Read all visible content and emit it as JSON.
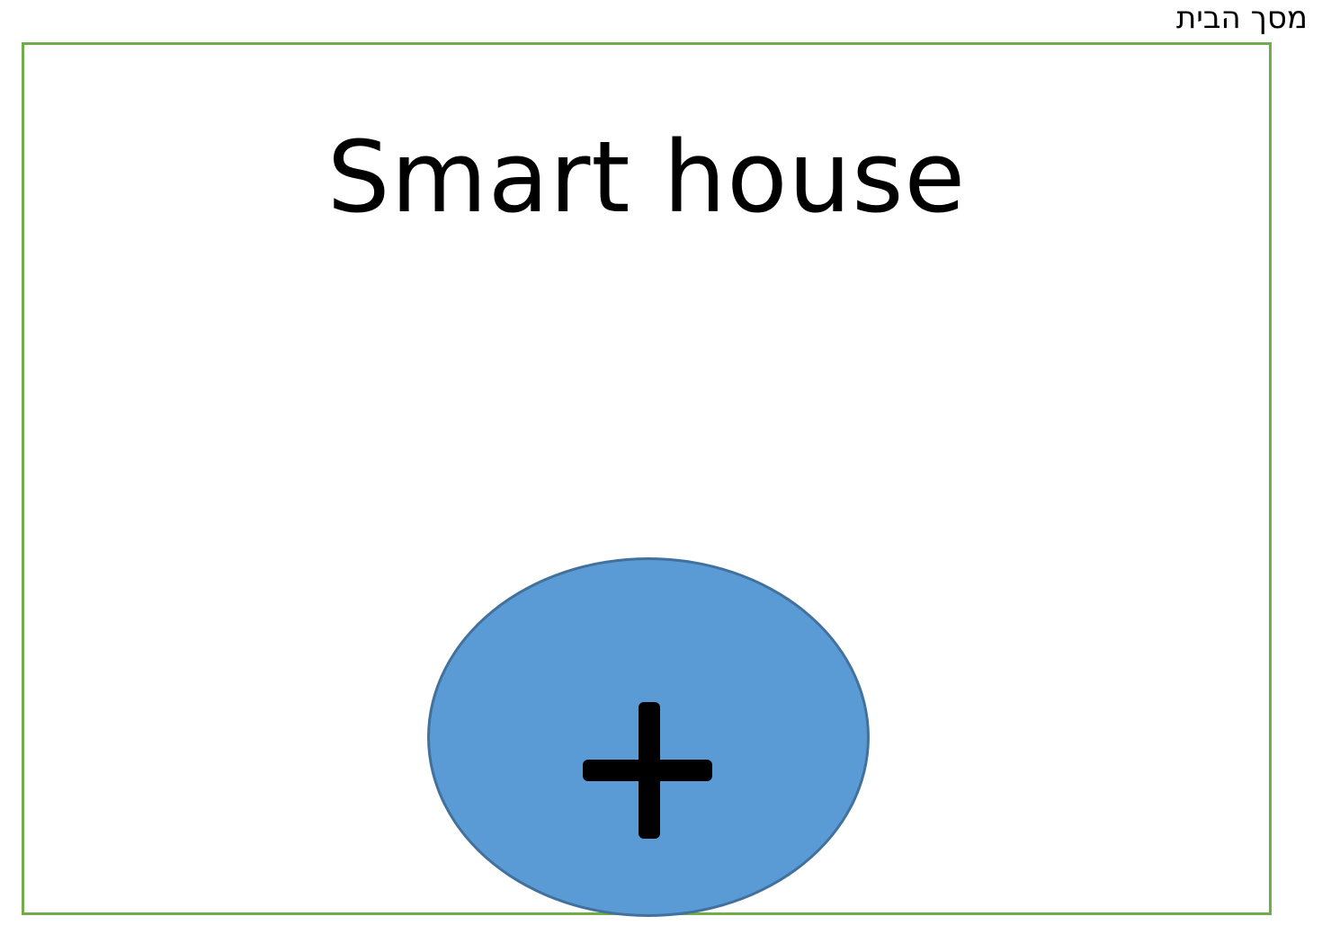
{
  "screen": {
    "label": "מסך הבית"
  },
  "app": {
    "title": "Smart house"
  },
  "add_button": {
    "icon": "plus-icon"
  },
  "colors": {
    "frame_border": "#70ad47",
    "button_fill": "#5b9bd5",
    "button_border": "#41719c",
    "text": "#000000"
  }
}
